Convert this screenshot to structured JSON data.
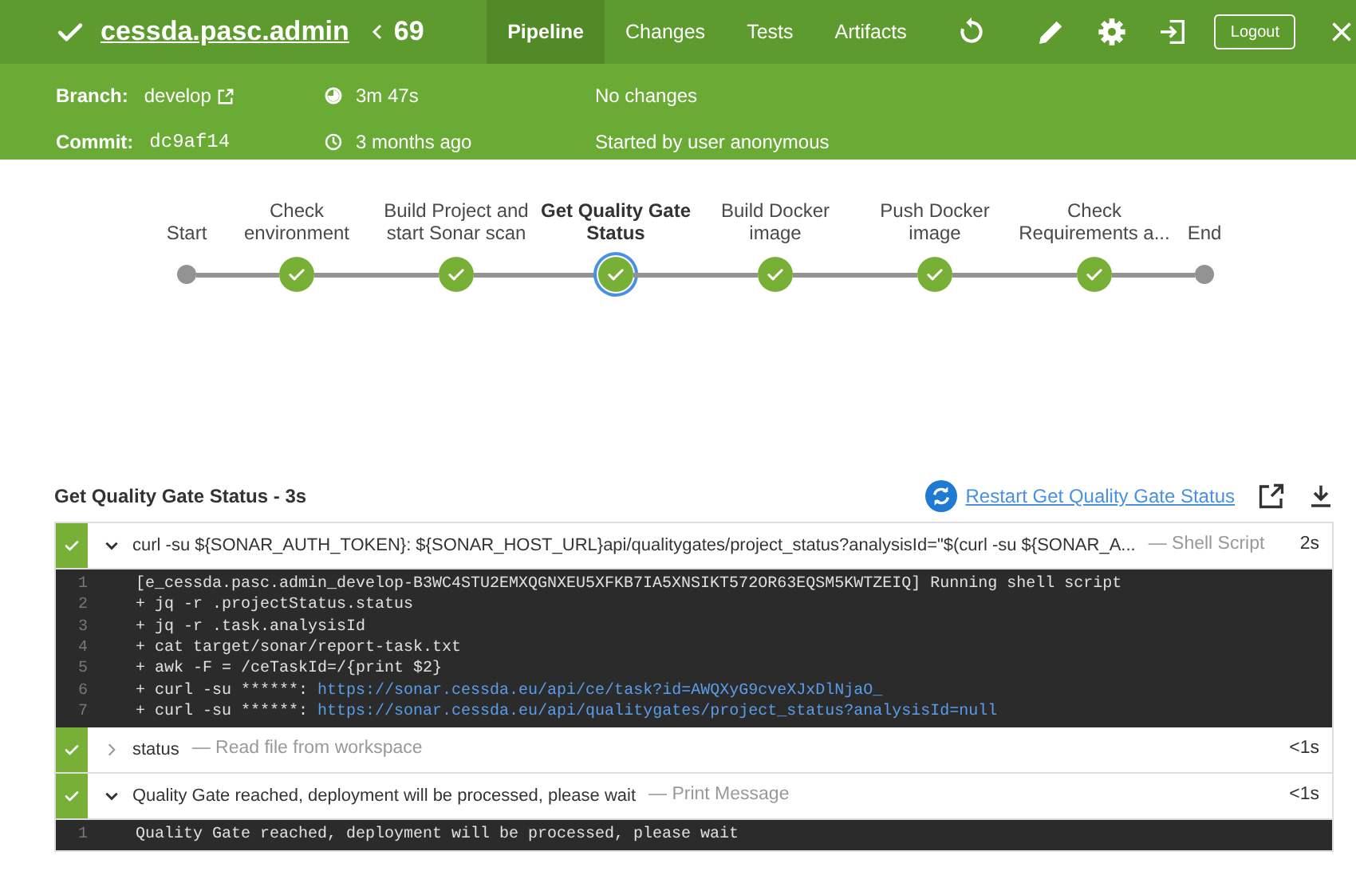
{
  "header": {
    "succeeded": true,
    "project": "cessda.pasc.admin",
    "run_number": "69",
    "tabs": [
      {
        "label": "Pipeline",
        "selected": true
      },
      {
        "label": "Changes",
        "selected": false
      },
      {
        "label": "Tests",
        "selected": false
      },
      {
        "label": "Artifacts",
        "selected": false
      }
    ],
    "logout": "Logout"
  },
  "info": {
    "branch_label": "Branch:",
    "branch": "develop",
    "commit_label": "Commit:",
    "commit": "dc9af14",
    "duration": "3m 47s",
    "time": "3 months ago",
    "changes": "No changes",
    "cause": "Started by user anonymous"
  },
  "stages": [
    {
      "label": "Start",
      "kind": "start",
      "selected": false
    },
    {
      "label": "Check environment",
      "kind": "success",
      "selected": false
    },
    {
      "label": "Build Project and start Sonar scan",
      "kind": "success",
      "selected": false
    },
    {
      "label": "Get Quality Gate Status",
      "kind": "success",
      "selected": true
    },
    {
      "label": "Build Docker image",
      "kind": "success",
      "selected": false
    },
    {
      "label": "Push Docker image",
      "kind": "success",
      "selected": false
    },
    {
      "label": "Check Requirements a...",
      "kind": "success",
      "selected": false
    },
    {
      "label": "End",
      "kind": "end",
      "selected": false
    }
  ],
  "stage_detail": {
    "title": "Get Quality Gate Status - 3s",
    "restart": "Restart Get Quality Gate Status",
    "steps": [
      {
        "succeeded": true,
        "expanded": true,
        "title": "curl -su ${SONAR_AUTH_TOKEN}: ${SONAR_HOST_URL}api/qualitygates/project_status?analysisId=\"$(curl -su ${SONAR_A...",
        "type": "— Shell Script",
        "duration": "2s",
        "log": [
          {
            "number": "1",
            "text": "[e_cessda.pasc.admin_develop-B3WC4STU2EMXQGNXEU5XFKB7IA5XNSIKT572OR63EQSM5KWTZEIQ] Running shell script"
          },
          {
            "number": "2",
            "text": "+ jq -r .projectStatus.status"
          },
          {
            "number": "3",
            "text": "+ jq -r .task.analysisId"
          },
          {
            "number": "4",
            "text": "+ cat target/sonar/report-task.txt"
          },
          {
            "number": "5",
            "text": "+ awk -F = /ceTaskId=/{print $2}"
          },
          {
            "number": "6",
            "text": "+ curl -su ******: ",
            "link": "https://sonar.cessda.eu/api/ce/task?id=AWQXyG9cveXJxDlNjaO_"
          },
          {
            "number": "7",
            "text": "+ curl -su ******: ",
            "link": "https://sonar.cessda.eu/api/qualitygates/project_status?analysisId=null"
          }
        ]
      },
      {
        "succeeded": true,
        "expanded": false,
        "title": "status",
        "type": "— Read file from workspace",
        "duration": "<1s"
      },
      {
        "succeeded": true,
        "expanded": true,
        "title": "Quality Gate reached, deployment will be processed, please wait",
        "type": "— Print Message",
        "duration": "<1s",
        "log": [
          {
            "number": "1",
            "text": "Quality Gate reached, deployment will be processed, please wait"
          }
        ]
      }
    ]
  }
}
